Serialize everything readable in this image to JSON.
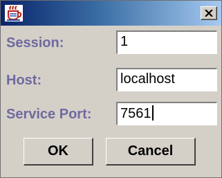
{
  "window": {
    "icon": "java-cup-icon",
    "close_icon": "close-x-icon",
    "title": ""
  },
  "form": {
    "session_label": "Session:",
    "session_value": "1",
    "host_label": "Host:",
    "host_value": "localhost",
    "port_label": "Service Port:",
    "port_value": "7561"
  },
  "buttons": {
    "ok_label": "OK",
    "cancel_label": "Cancel"
  },
  "colors": {
    "titlebar_start": "#0a246a",
    "titlebar_end": "#a6caf0",
    "label_text": "#6f6a9e",
    "dialog_bg": "#d4d0c8"
  }
}
